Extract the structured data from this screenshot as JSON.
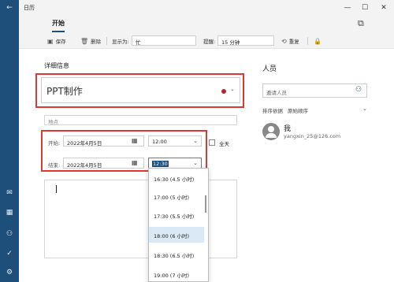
{
  "window": {
    "title": "日历"
  },
  "tabs": [
    {
      "label": "开始"
    }
  ],
  "toolbar": {
    "save_label": "保存",
    "delete_label": "删除",
    "show_as_label": "显示为:",
    "show_as_value": "忙",
    "reminder_label": "提醒:",
    "reminder_value": "15 分钟",
    "repeat_label": "重复"
  },
  "details": {
    "section_title": "详细信息",
    "event_title": "PPT制作",
    "location_placeholder": "地点",
    "start_label": "开始:",
    "start_date": "2022年4月5日",
    "start_time": "12:00",
    "end_label": "结束:",
    "end_date": "2022年4月5日",
    "end_time": "12:30",
    "all_day_label": "全天"
  },
  "time_options": [
    {
      "label": "16:30 (4.5 小时)"
    },
    {
      "label": "17:00 (5 小时)"
    },
    {
      "label": "17:30 (5.5 小时)"
    },
    {
      "label": "18:00 (6 小时)",
      "selected": true
    },
    {
      "label": "18:30 (6.5 小时)"
    },
    {
      "label": "19:00 (7 小时)"
    }
  ],
  "people": {
    "section_title": "人员",
    "invite_placeholder": "邀请人员",
    "sort_label": "排序依据",
    "sort_value": "原始顺序",
    "me_name": "我",
    "me_email": "yangxin_25@126.com"
  },
  "colors": {
    "sidebar": "#1e4f7a",
    "highlight_box": "#d93a36",
    "calendar_dot": "#b0282c",
    "selected_option": "#dbe8f5"
  },
  "icons": [
    "back-arrow-icon",
    "mail-icon",
    "calendar-icon",
    "people-icon",
    "todo-icon",
    "settings-icon",
    "save-icon",
    "delete-icon",
    "repeat-icon",
    "lock-icon",
    "calendar-picker-icon",
    "invite-person-icon"
  ]
}
